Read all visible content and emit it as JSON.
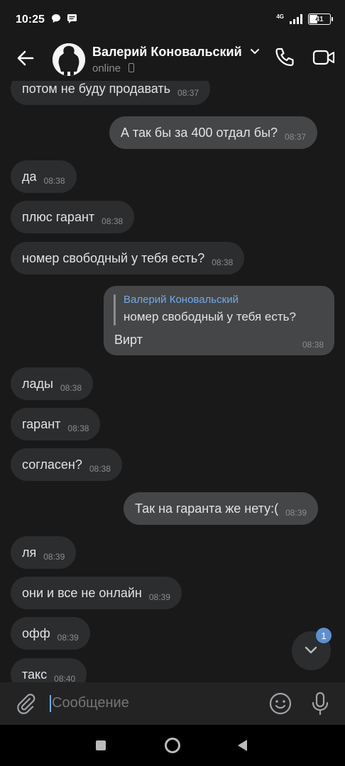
{
  "status_bar": {
    "time": "10:25",
    "network": "4G",
    "battery": "41"
  },
  "header": {
    "contact_name": "Валерий Коновальский",
    "status": "online"
  },
  "messages": [
    {
      "dir": "in",
      "text": "потом не буду продавать",
      "time": "08:37"
    },
    {
      "dir": "out",
      "text": "А так бы за 400 отдал бы?",
      "time": "08:37"
    },
    {
      "dir": "in",
      "text": "да",
      "time": "08:38"
    },
    {
      "dir": "in",
      "text": "плюс гарант",
      "time": "08:38"
    },
    {
      "dir": "in",
      "text": "номер свободный у тебя есть?",
      "time": "08:38"
    },
    {
      "dir": "out",
      "reply_to": {
        "author": "Валерий Коновальский",
        "text": "номер свободный у тебя есть?"
      },
      "text": "Вирт",
      "time": "08:38"
    },
    {
      "dir": "in",
      "text": "лады",
      "time": "08:38"
    },
    {
      "dir": "in",
      "text": "гарант",
      "time": "08:38"
    },
    {
      "dir": "in",
      "text": "согласен?",
      "time": "08:38"
    },
    {
      "dir": "out",
      "text": "Так на гаранта же нету:(",
      "time": "08:39"
    },
    {
      "dir": "in",
      "text": "ля",
      "time": "08:39"
    },
    {
      "dir": "in",
      "text": "они и все не онлайн",
      "time": "08:39"
    },
    {
      "dir": "in",
      "text": "офф",
      "time": "08:39"
    },
    {
      "dir": "in",
      "text": "такс",
      "time": "08:40"
    }
  ],
  "scroll_down": {
    "unread_count": "1"
  },
  "composer": {
    "placeholder": "Сообщение"
  },
  "colors": {
    "background": "#19191a",
    "incoming_bubble": "#2c2d2e",
    "outgoing_bubble": "#454647",
    "accent": "#71aaeb",
    "badge": "#5d90cf"
  },
  "icons": [
    "back-arrow-icon",
    "chevron-down-icon",
    "phone-icon",
    "video-call-icon",
    "chevron-down-icon",
    "paperclip-icon",
    "smile-icon",
    "microphone-icon"
  ]
}
